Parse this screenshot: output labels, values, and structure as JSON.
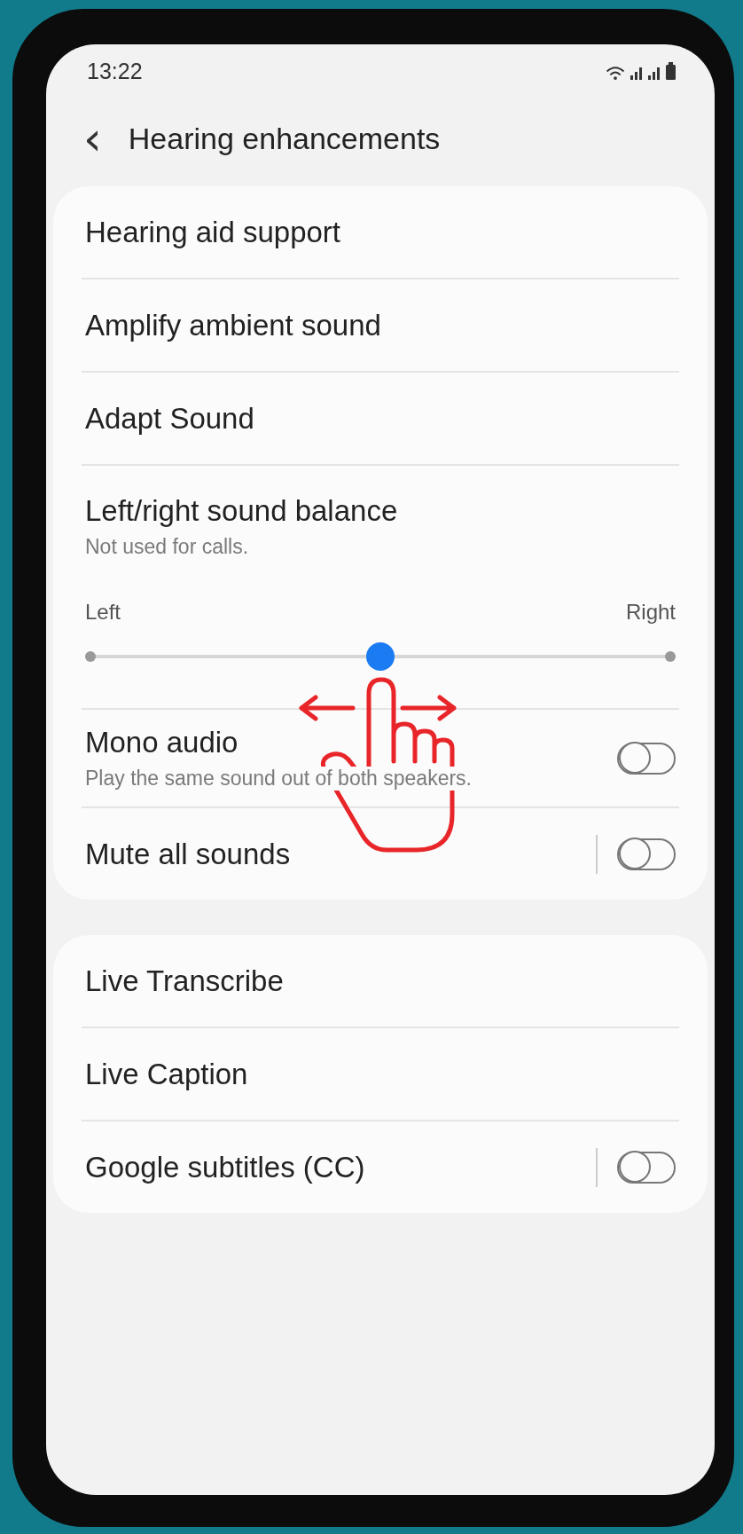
{
  "status_bar": {
    "time": "13:22"
  },
  "header": {
    "back": "‹",
    "title": "Hearing enhancements"
  },
  "groups": [
    {
      "items": [
        {
          "kind": "link",
          "label": "Hearing aid support"
        },
        {
          "kind": "link",
          "label": "Amplify ambient sound"
        },
        {
          "kind": "link",
          "label": "Adapt Sound"
        },
        {
          "kind": "slider",
          "label": "Left/right sound balance",
          "subtitle": "Not used for calls.",
          "left_label": "Left",
          "right_label": "Right",
          "level": 0.5
        },
        {
          "kind": "toggle",
          "label": "Mono audio",
          "subtitle": "Play the same sound out of both speakers.",
          "on": false,
          "divider": false
        },
        {
          "kind": "toggle",
          "label": "Mute all sounds",
          "on": false,
          "divider": true
        }
      ]
    },
    {
      "items": [
        {
          "kind": "link",
          "label": "Live Transcribe"
        },
        {
          "kind": "link",
          "label": "Live Caption"
        },
        {
          "kind": "toggle",
          "label": "Google subtitles (CC)",
          "on": false,
          "divider": true
        }
      ]
    }
  ]
}
